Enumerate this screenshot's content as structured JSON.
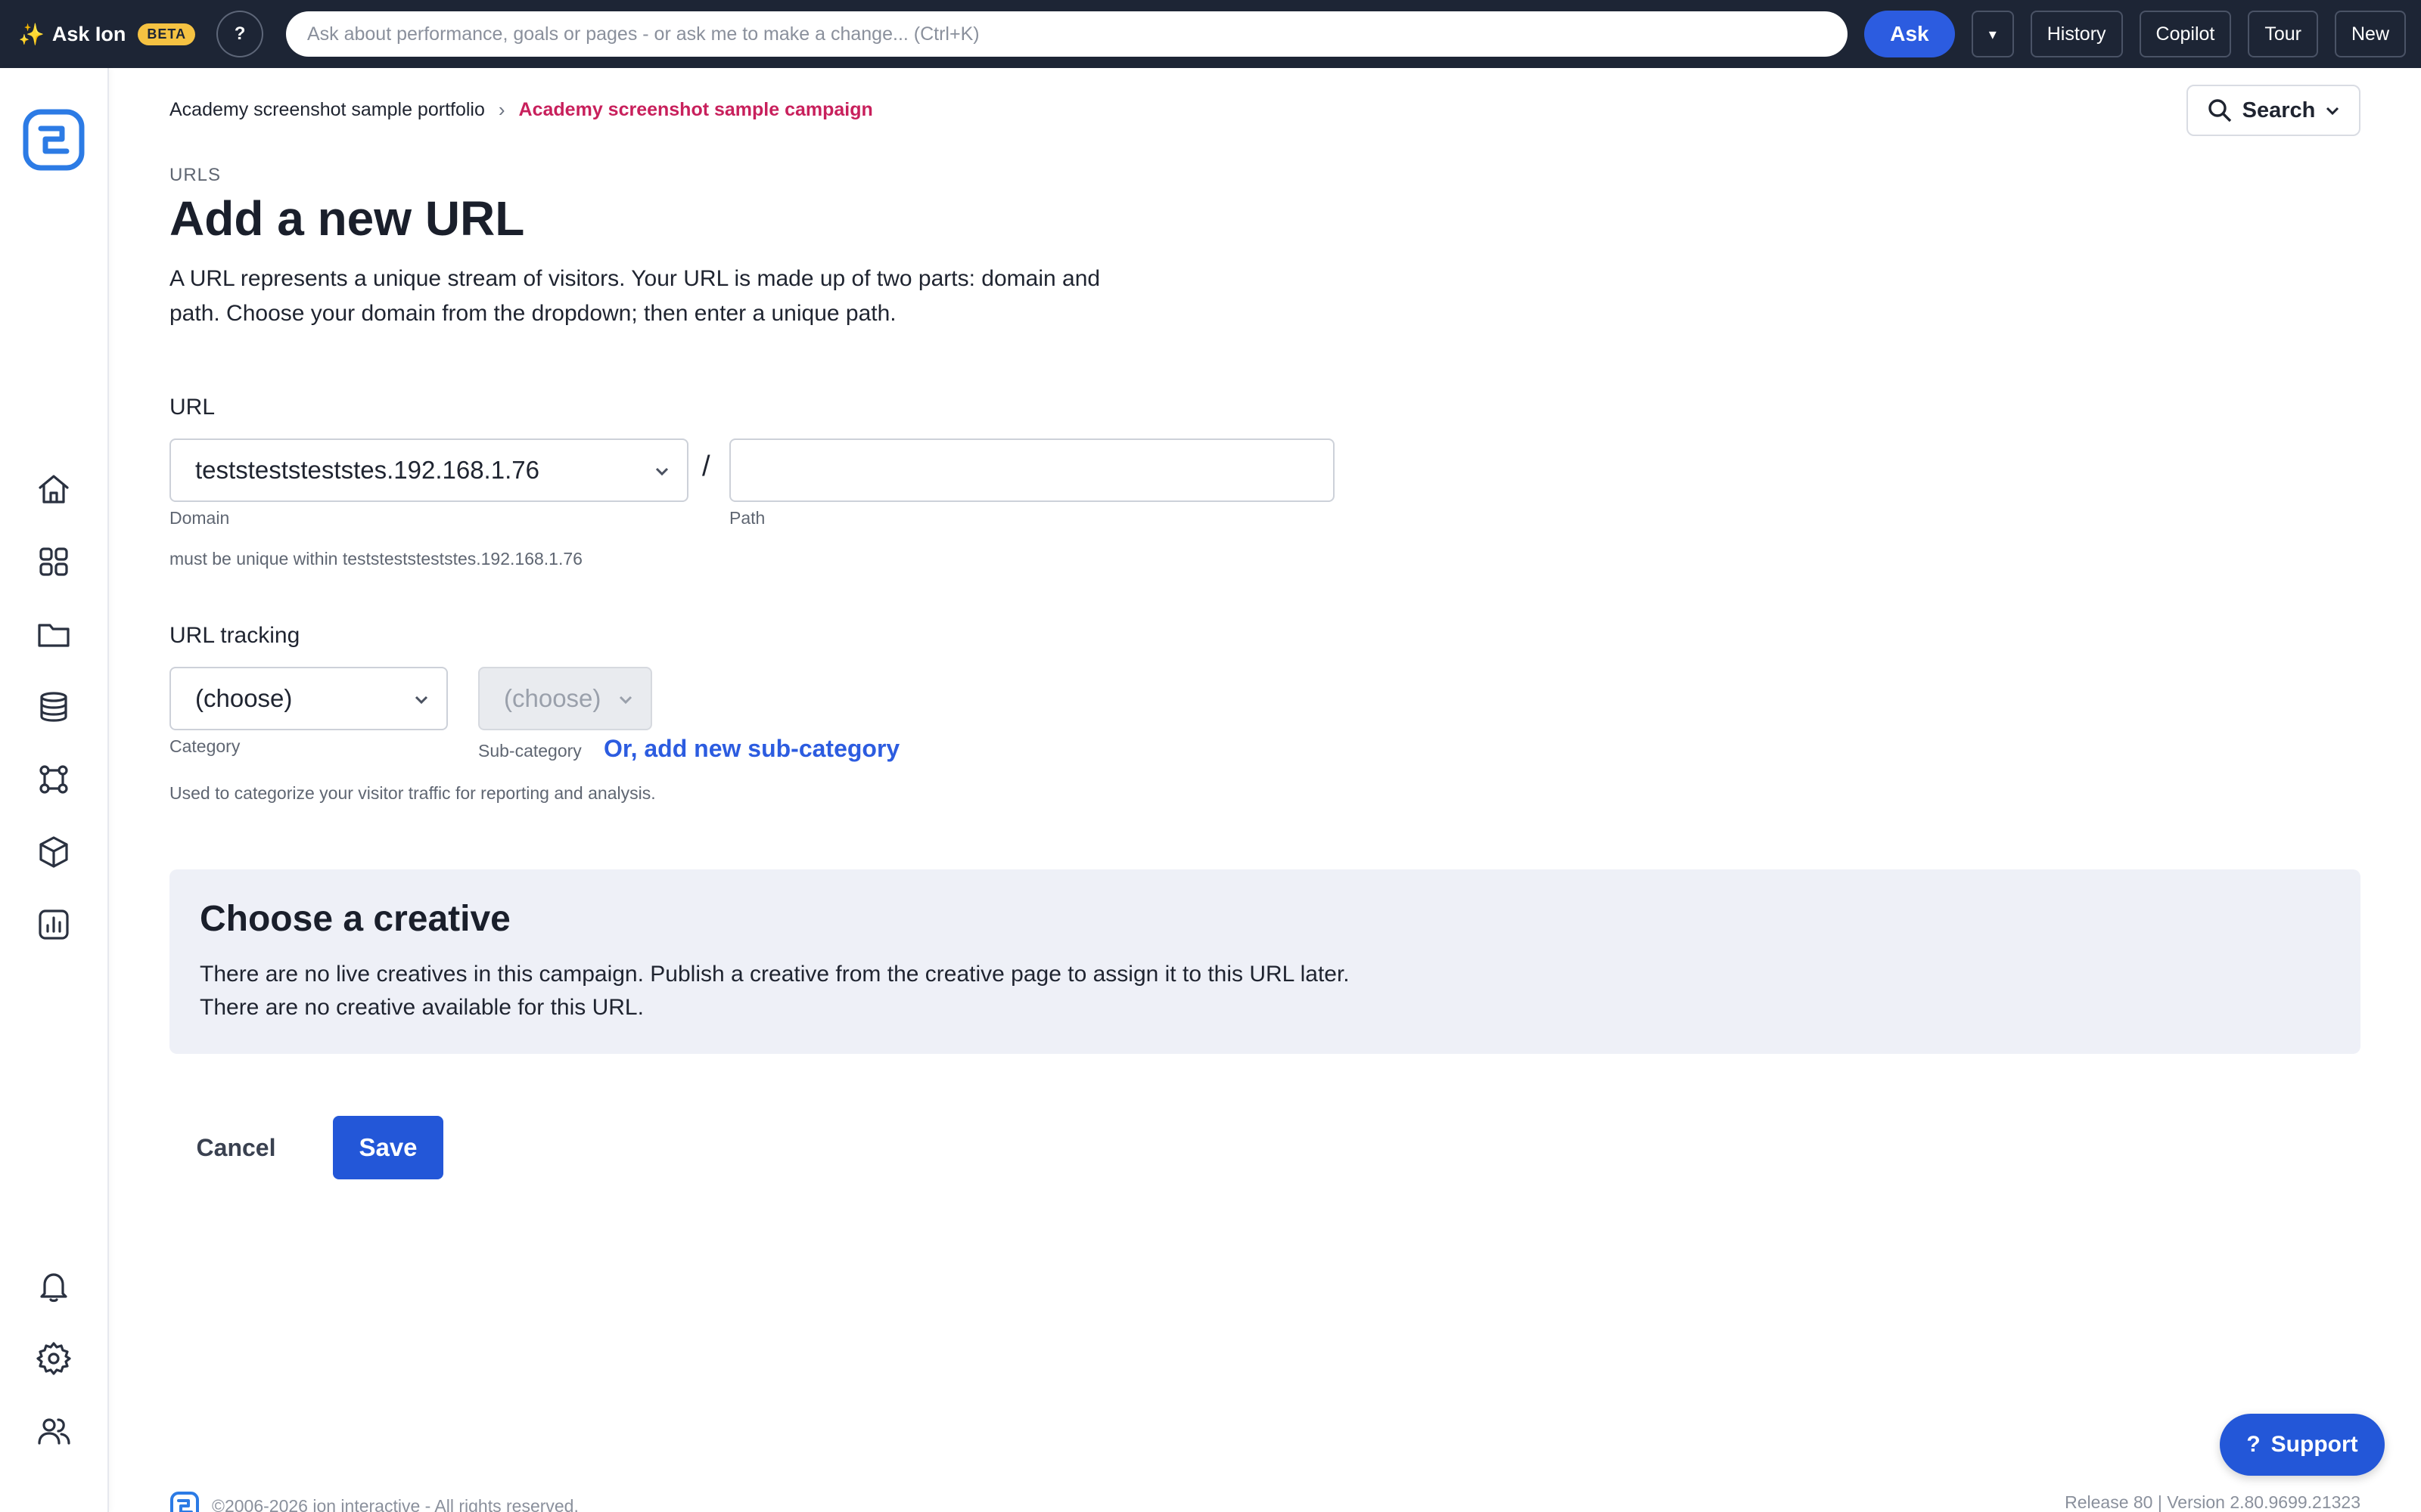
{
  "topbar": {
    "brand_label": "Ask Ion",
    "beta_badge": "BETA",
    "help_label": "?",
    "ask_placeholder": "Ask about performance, goals or pages - or ask me to make a change... (Ctrl+K)",
    "ask_button": "Ask",
    "dropdown_caret": "▾",
    "history_button": "History",
    "copilot_button": "Copilot",
    "tour_button": "Tour",
    "new_button": "New"
  },
  "breadcrumb": {
    "portfolio": "Academy screenshot sample portfolio",
    "separator": "›",
    "campaign": "Academy screenshot sample campaign"
  },
  "search": {
    "label": "Search"
  },
  "page": {
    "eyebrow": "URLS",
    "title": "Add a new URL",
    "intro": "A URL represents a unique stream of visitors. Your URL is made up of two parts: domain and path. Choose your domain from the dropdown; then enter a unique path."
  },
  "url_section": {
    "label": "URL",
    "domain_value": "teststeststeststes.192.168.1.76",
    "slash": "/",
    "path_value": "",
    "domain_label": "Domain",
    "path_label": "Path",
    "hint": "must be unique within teststeststeststes.192.168.1.76"
  },
  "tracking_section": {
    "label": "URL tracking",
    "category_value": "(choose)",
    "subcategory_value": "(choose)",
    "category_label": "Category",
    "subcategory_label": "Sub-category",
    "add_subcategory_link": "Or, add new sub-category",
    "hint": "Used to categorize your visitor traffic for reporting and analysis."
  },
  "creative": {
    "title": "Choose a creative",
    "line1": "There are no live creatives in this campaign. Publish a creative from the creative page to assign it to this URL later.",
    "line2": "There are no creative available for this URL."
  },
  "actions": {
    "cancel": "Cancel",
    "save": "Save"
  },
  "footer": {
    "copyright": "©2006-2026 ion interactive - All rights reserved.",
    "version": "Release 80 | Version 2.80.9699.21323"
  },
  "support": {
    "icon": "?",
    "label": "Support"
  },
  "colors": {
    "topbar_bg": "#1d2535",
    "accent_blue": "#2357d8",
    "breadcrumb_current": "#c8205c",
    "beta_badge": "#f5c242",
    "creative_panel_bg": "#eef0f7"
  }
}
